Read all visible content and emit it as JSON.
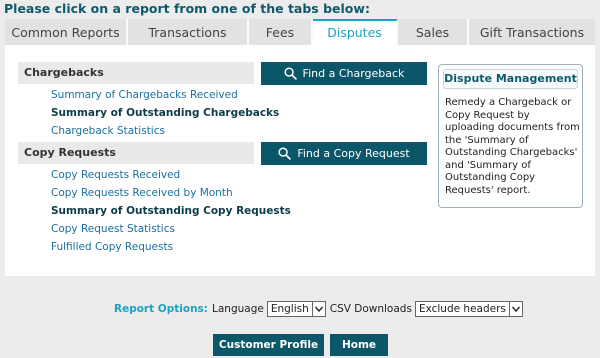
{
  "heading": "Please click on a report from one of the tabs below:",
  "tabs": [
    {
      "label": "Common Reports"
    },
    {
      "label": "Transactions"
    },
    {
      "label": "Fees"
    },
    {
      "label": "Disputes"
    },
    {
      "label": "Sales"
    },
    {
      "label": "Gift Transactions"
    }
  ],
  "active_tab": "Disputes",
  "chargebacks": {
    "header": "Chargebacks",
    "links": [
      "Summary of Chargebacks Received",
      "Summary of Outstanding Chargebacks",
      "Chargeback Statistics"
    ],
    "find_button": "Find a Chargeback"
  },
  "copy_requests": {
    "header": "Copy Requests",
    "links": [
      "Copy Requests Received",
      "Copy Requests Received by Month",
      "Summary of Outstanding Copy Requests",
      "Copy Request Statistics",
      "Fulfilled Copy Requests"
    ],
    "find_button": "Find a Copy Request"
  },
  "dispute_management": {
    "title": "Dispute Management",
    "text": "Remedy a Chargeback or Copy Request by uploading documents from the 'Summary of Outstanding Chargebacks' and 'Summary of Outstanding Copy Requests' report."
  },
  "report_options": {
    "label": "Report Options:",
    "language_label": "Language",
    "language_value": "English",
    "csv_label": "CSV Downloads",
    "csv_value": "Exclude headers"
  },
  "buttons": {
    "customer_profile": "Customer Profile",
    "home": "Home"
  },
  "colors": {
    "accent": "#1aa3c4",
    "button": "#0c5669",
    "heading": "#0e5a6c"
  }
}
